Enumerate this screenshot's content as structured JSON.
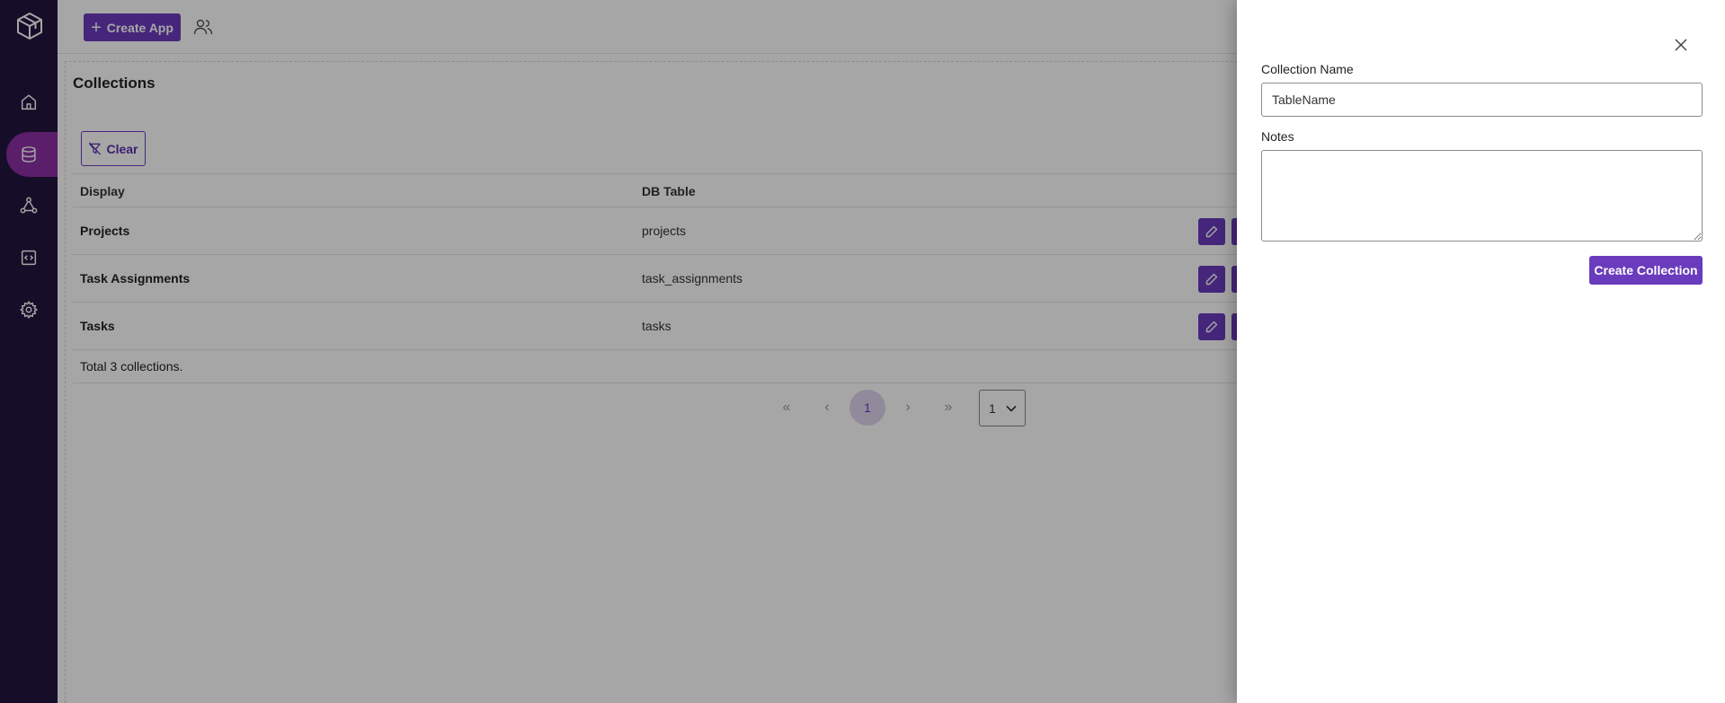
{
  "sidebar": {
    "items": [
      {
        "icon": "home-icon",
        "active": false
      },
      {
        "icon": "database-icon",
        "active": true
      },
      {
        "icon": "workflow-icon",
        "active": false
      },
      {
        "icon": "code-icon",
        "active": false
      },
      {
        "icon": "settings-icon",
        "active": false
      }
    ],
    "logo": "box-logo-icon"
  },
  "topbar": {
    "create_app_label": "Create App",
    "users_icon": "users-icon"
  },
  "main": {
    "title": "Collections",
    "clear_label": "Clear",
    "columns": [
      "Display",
      "DB Table"
    ],
    "rows": [
      {
        "display": "Projects",
        "db_table": "projects"
      },
      {
        "display": "Task Assignments",
        "db_table": "task_assignments"
      },
      {
        "display": "Tasks",
        "db_table": "tasks"
      }
    ],
    "total_text": "Total 3 collections.",
    "pagination": {
      "first": "«",
      "prev": "‹",
      "current_page": "1",
      "next": "›",
      "last": "»",
      "page_select_value": "1"
    }
  },
  "drawer": {
    "collection_name_label": "Collection Name",
    "collection_name_value": "TableName",
    "notes_label": "Notes",
    "notes_value": "",
    "create_button_label": "Create Collection"
  },
  "colors": {
    "sidebar_bg": "#231640",
    "sidebar_active": "#8a2fa3",
    "primary": "#6a3bbd",
    "overlay": "rgba(0,0,0,0.35)"
  }
}
